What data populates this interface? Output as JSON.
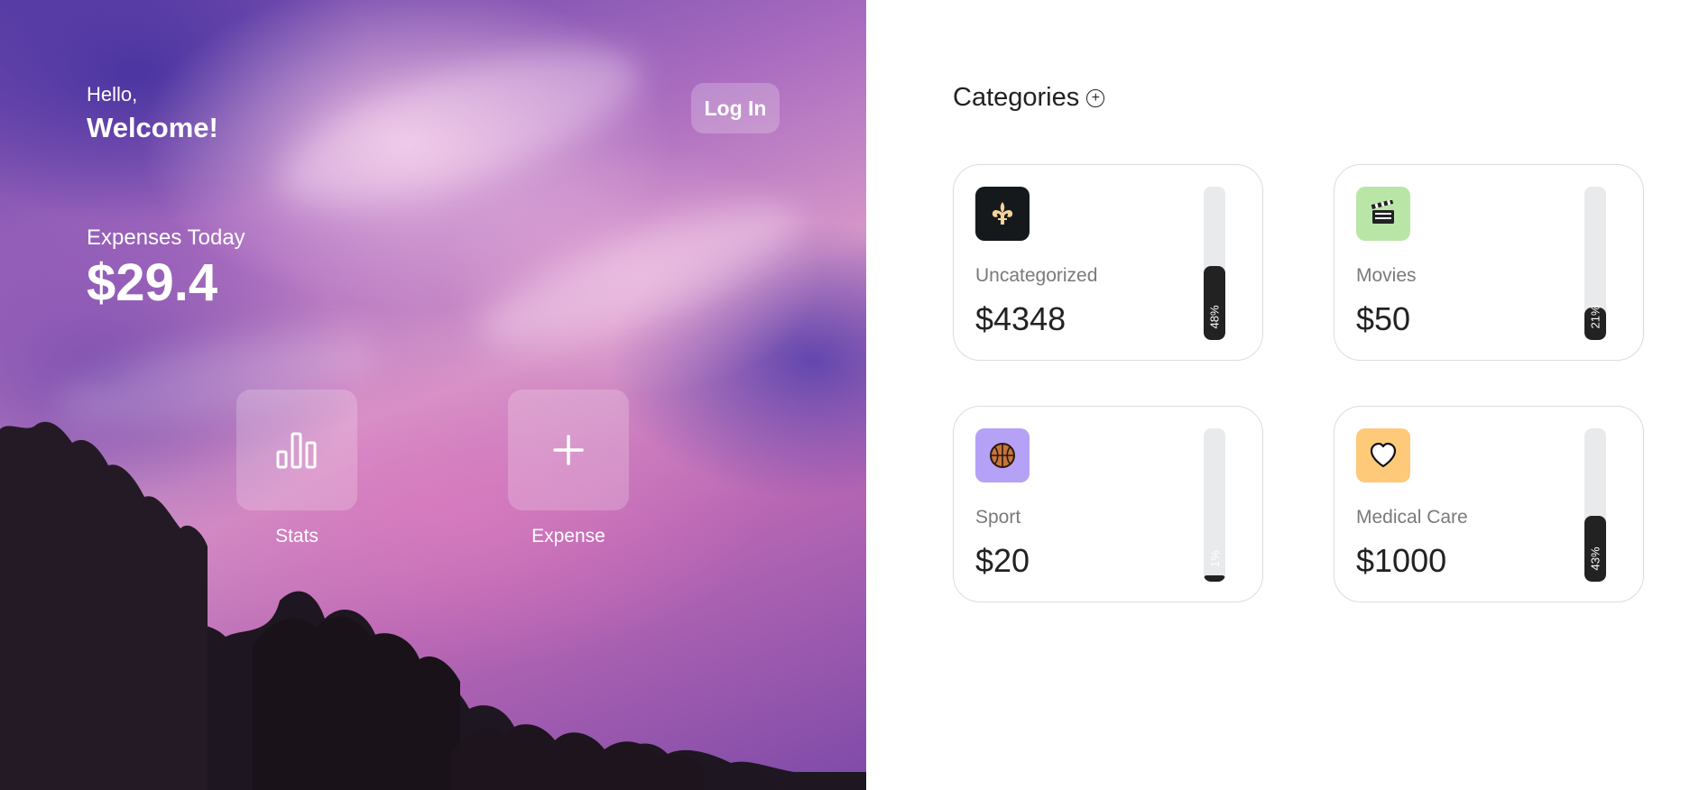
{
  "header": {
    "greeting": "Hello,",
    "welcome": "Welcome!",
    "login_label": "Log In"
  },
  "expenses": {
    "label": "Expenses Today",
    "value": "$29.4"
  },
  "actions": [
    {
      "label": "Stats",
      "icon": "bar-chart-icon"
    },
    {
      "label": "Expense",
      "icon": "plus-icon"
    }
  ],
  "categories": {
    "title": "Categories",
    "add_icon": "plus-circle-icon",
    "items": [
      {
        "name": "Uncategorized",
        "amount": "$4348",
        "percent_label": "48%",
        "percent": 48,
        "icon": "fleur-de-lis-icon",
        "icon_bg": "#15191b"
      },
      {
        "name": "Movies",
        "amount": "$50",
        "percent_label": "21%",
        "percent": 21,
        "icon": "clapperboard-icon",
        "icon_bg": "#b9e6a6"
      },
      {
        "name": "Sport",
        "amount": "$20",
        "percent_label": "1%",
        "percent": 1,
        "icon": "basketball-icon",
        "icon_bg": "#b5a1f5"
      },
      {
        "name": "Medical Care",
        "amount": "$1000",
        "percent_label": "43%",
        "percent": 43,
        "icon": "heart-icon",
        "icon_bg": "#ffc97a"
      }
    ]
  },
  "colors": {
    "bar_fill": "#222222",
    "bar_track": "#e8eaec"
  }
}
